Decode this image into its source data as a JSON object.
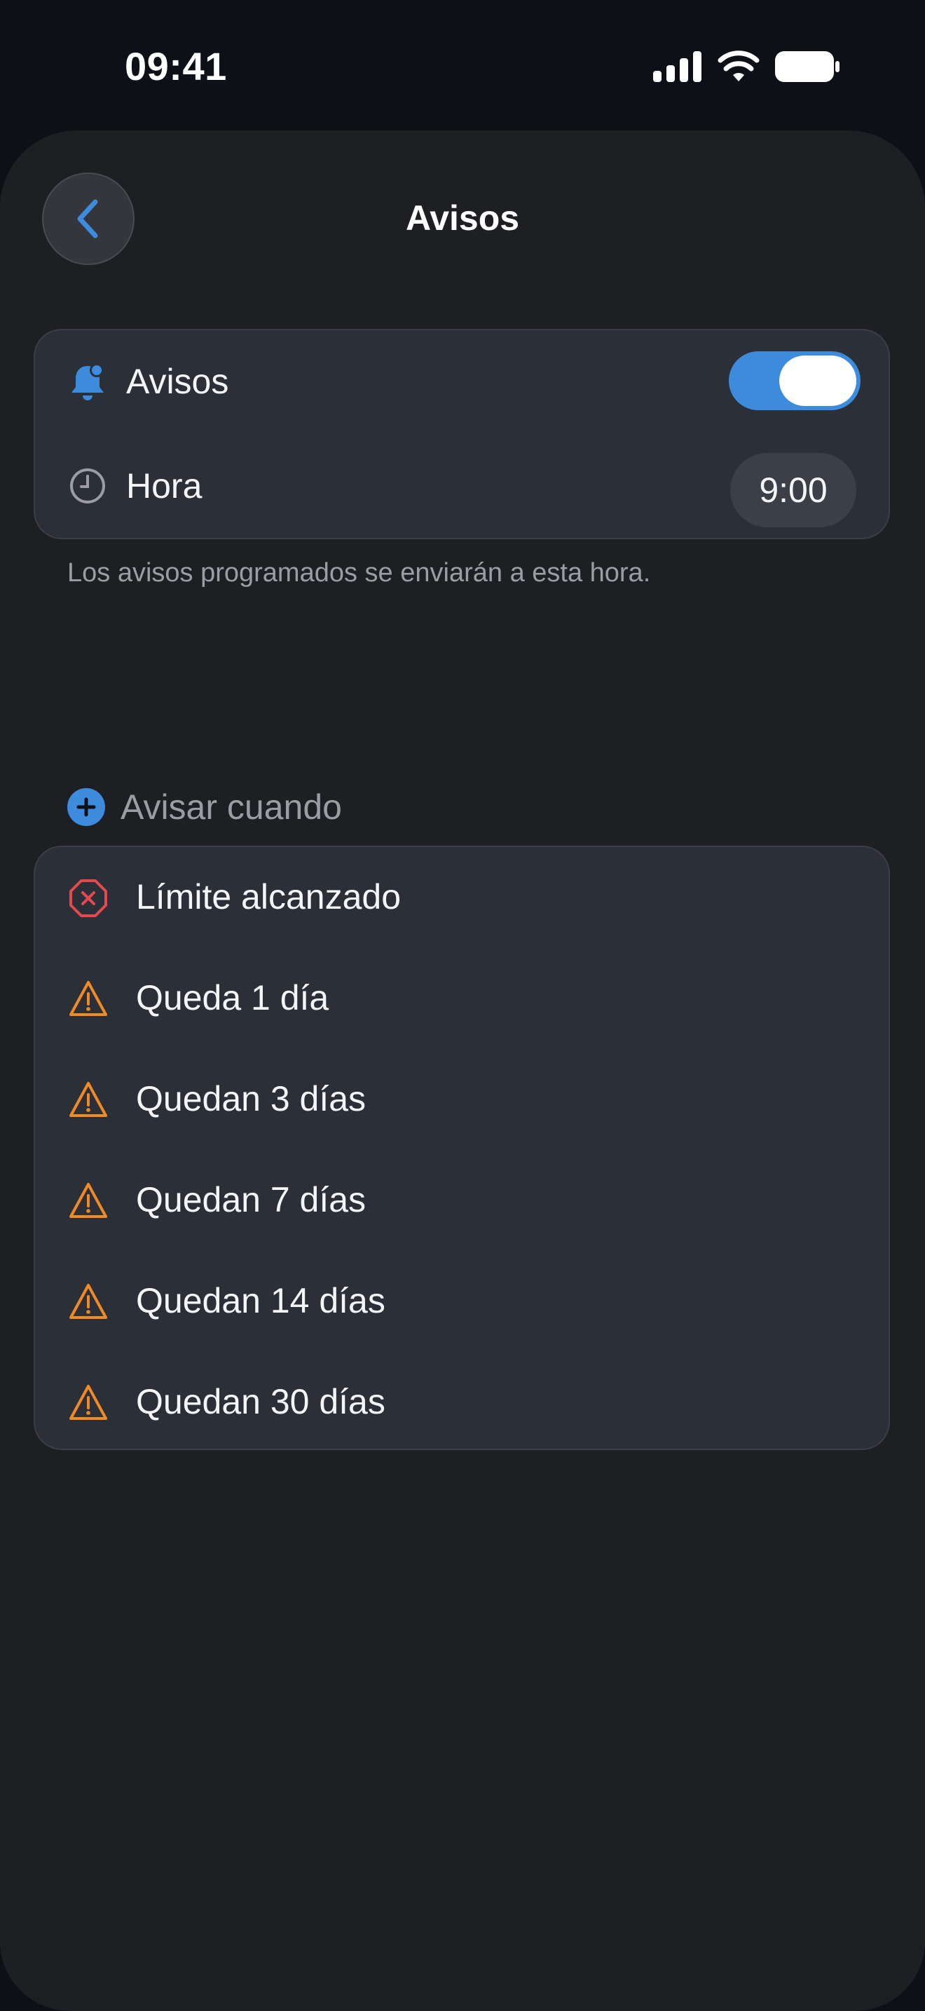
{
  "status_bar": {
    "time": "09:41",
    "icons": [
      "cellular-signal-icon",
      "wifi-icon",
      "battery-icon"
    ]
  },
  "nav": {
    "back_icon": "chevron-left-icon",
    "title": "Avisos"
  },
  "settings": {
    "alerts": {
      "icon": "bell-badge-icon",
      "label": "Avisos",
      "enabled": true
    },
    "time": {
      "icon": "clock-icon",
      "label": "Hora",
      "value": "9:00"
    },
    "footnote": "Los avisos programados se enviarán a esta hora."
  },
  "section": {
    "icon": "plus-circle-icon",
    "title": "Avisar cuando"
  },
  "alert_rules": [
    {
      "icon": "x-octagon-icon",
      "label": "Límite alcanzado",
      "color": "#e5484d"
    },
    {
      "icon": "warning-triangle-icon",
      "label": "Queda 1 día",
      "color": "#f08a24"
    },
    {
      "icon": "warning-triangle-icon",
      "label": "Quedan 3 días",
      "color": "#f08a24"
    },
    {
      "icon": "warning-triangle-icon",
      "label": "Quedan 7 días",
      "color": "#f08a24"
    },
    {
      "icon": "warning-triangle-icon",
      "label": "Quedan 14 días",
      "color": "#f08a24"
    },
    {
      "icon": "warning-triangle-icon",
      "label": "Quedan 30 días",
      "color": "#f08a24"
    }
  ],
  "colors": {
    "accent": "#3d8bdc",
    "background": "#1e1f23",
    "card": "#2b3038",
    "danger": "#e5484d",
    "warning": "#f08a24"
  }
}
